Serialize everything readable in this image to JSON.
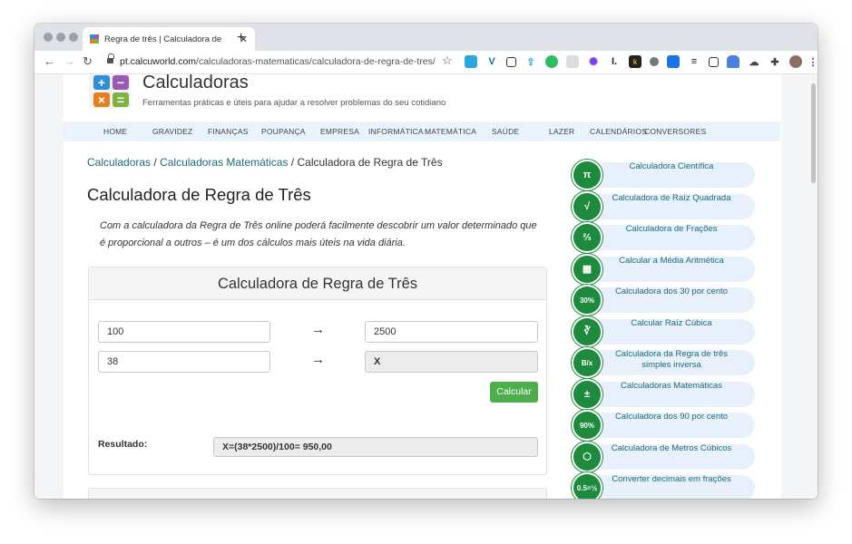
{
  "browser": {
    "tab_title": "Regra de três | Calculadora de",
    "tab_close": "✕",
    "new_tab": "+",
    "url_domain": "pt.calcuworld.com",
    "url_path": "/calculadoras-matematicas/calculadora-de-regra-de-tres/"
  },
  "site": {
    "name": "Calculadoras",
    "tagline": "Ferramentas práticas e úteis para ajudar a resolver problemas do seu cotidiano",
    "logo_symbols": [
      "+",
      "−",
      "×",
      "="
    ]
  },
  "nav": [
    "HOME",
    "GRAVIDEZ",
    "FINANÇAS",
    "POUPANÇA",
    "EMPRESA",
    "INFORMÁTICA",
    "MATEMÁTICA",
    "SAÚDE",
    "LAZER",
    "CALENDÁRIOS",
    "CONVERSORES"
  ],
  "breadcrumb": {
    "item1": "Calculadoras",
    "sep1": " / ",
    "item2": "Calculadoras Matemáticas",
    "sep2": " / ",
    "current": "Calculadora de Regra de Três"
  },
  "page": {
    "title": "Calculadora de Regra de Três",
    "intro": "Com a calculadora da Regra de Três online poderá facilmente descobrir um valor determinado que é proporcional a outros – é um dos cálculos mais úteis na vida diária."
  },
  "calculator": {
    "title": "Calculadora de Regra de Três",
    "a": "100",
    "b": "2500",
    "c": "38",
    "x": "X",
    "arrow": "→",
    "button": "Calcular",
    "result_label": "Resultado:",
    "result_value": "X=(38*2500)/100= 950,00"
  },
  "sidebar": [
    {
      "label": "Calculadora Científica",
      "icon": "pi-icon",
      "glyph": "π"
    },
    {
      "label": "Calculadora de Raíz Quadrada",
      "icon": "square-root-icon",
      "glyph": "√"
    },
    {
      "label": "Calculadora de Frações",
      "icon": "fraction-icon",
      "glyph": "⅔"
    },
    {
      "label": "Calcular a Média Aritmética",
      "icon": "chart-icon",
      "glyph": "▦"
    },
    {
      "label": "Calculadora dos 30 por cento",
      "icon": "percent-30-icon",
      "glyph": "30%"
    },
    {
      "label": "Calcular Raíz Cúbica",
      "icon": "cube-root-icon",
      "glyph": "∛"
    },
    {
      "label": "Calculadora da Regra de três simples inversa",
      "icon": "rule-of-three-icon",
      "glyph": "B/x"
    },
    {
      "label": "Calculadoras Matemáticas",
      "icon": "calculator-icon",
      "glyph": "±"
    },
    {
      "label": "Calculadora dos 90 por cento",
      "icon": "percent-90-icon",
      "glyph": "90%"
    },
    {
      "label": "Calculadora de Metros Cúbicos",
      "icon": "cube-icon",
      "glyph": "⬡"
    },
    {
      "label": "Converter decimais em frações",
      "icon": "decimal-fraction-icon",
      "glyph": "0.5=½"
    }
  ],
  "colors": {
    "accent_green": "#1e8a3d",
    "button_green": "#4cae4c",
    "link_teal": "#1e6b7b",
    "nav_bg": "#eaf2fb",
    "logo_blue": "#2e8fd8",
    "logo_purple": "#9b59b6",
    "logo_orange": "#e67e22",
    "logo_green": "#7cb342"
  }
}
